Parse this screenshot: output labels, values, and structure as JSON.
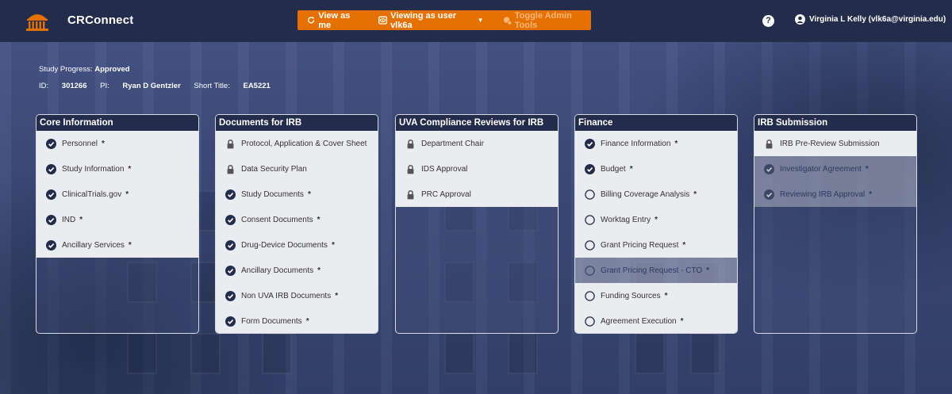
{
  "header": {
    "brand": "CRConnect",
    "admin": {
      "view_as_me": "View as me",
      "viewing_as": "Viewing as user vlk6a",
      "toggle_admin": "Toggle Admin Tools"
    },
    "help_glyph": "?",
    "user_label": "Virginia L Kelly (vlk6a@virginia.edu)"
  },
  "study": {
    "progress_label": "Study Progress:",
    "progress_value": "Approved",
    "id_label": "ID:",
    "id_value": "301266",
    "pi_label": "PI:",
    "pi_value": "Ryan D Gentzler",
    "short_title_label": "Short Title:",
    "short_title_value": "EA5221"
  },
  "panels": [
    {
      "title": "Core Information",
      "items": [
        {
          "label": "Personnel",
          "status": "complete",
          "required": true
        },
        {
          "label": "Study Information",
          "status": "complete",
          "required": true
        },
        {
          "label": "ClinicalTrials.gov",
          "status": "complete",
          "required": true
        },
        {
          "label": "IND",
          "status": "complete",
          "required": true
        },
        {
          "label": "Ancillary Services",
          "status": "complete",
          "required": true
        }
      ]
    },
    {
      "title": "Documents for IRB",
      "items": [
        {
          "label": "Protocol, Application & Cover Sheet",
          "status": "locked",
          "required": false
        },
        {
          "label": "Data Security Plan",
          "status": "locked",
          "required": false
        },
        {
          "label": "Study Documents",
          "status": "complete",
          "required": true
        },
        {
          "label": "Consent Documents",
          "status": "complete",
          "required": true
        },
        {
          "label": "Drug-Device Documents",
          "status": "complete",
          "required": true
        },
        {
          "label": "Ancillary Documents",
          "status": "complete",
          "required": true
        },
        {
          "label": "Non UVA IRB Documents",
          "status": "complete",
          "required": true
        },
        {
          "label": "Form Documents",
          "status": "complete",
          "required": true
        }
      ]
    },
    {
      "title": "UVA Compliance Reviews for IRB",
      "items": [
        {
          "label": "Department Chair",
          "status": "locked",
          "required": false
        },
        {
          "label": "IDS Approval",
          "status": "locked",
          "required": false
        },
        {
          "label": "PRC Approval",
          "status": "locked",
          "required": false
        }
      ]
    },
    {
      "title": "Finance",
      "items": [
        {
          "label": "Finance Information",
          "status": "complete",
          "required": true
        },
        {
          "label": "Budget",
          "status": "complete",
          "required": true
        },
        {
          "label": "Billing Coverage Analysis",
          "status": "incomplete",
          "required": true
        },
        {
          "label": "Worktag Entry",
          "status": "incomplete",
          "required": true
        },
        {
          "label": "Grant Pricing Request",
          "status": "incomplete",
          "required": true
        },
        {
          "label": "Grant Pricing Request - CTO",
          "status": "incomplete",
          "required": true,
          "disabled": true
        },
        {
          "label": "Funding Sources",
          "status": "incomplete",
          "required": true
        },
        {
          "label": "Agreement Execution",
          "status": "incomplete",
          "required": true
        }
      ]
    },
    {
      "title": "IRB Submission",
      "items": [
        {
          "label": "IRB Pre-Review Submission",
          "status": "locked",
          "required": false
        },
        {
          "label": "Investigator Agreement",
          "status": "complete",
          "required": true,
          "disabled": true
        },
        {
          "label": "Reviewing IRB Approval",
          "status": "complete",
          "required": true,
          "disabled": true
        }
      ]
    }
  ],
  "required_marker": "*",
  "colors": {
    "navy": "#232d4b",
    "orange": "#e57200",
    "item_bg": "#ebecf0"
  }
}
